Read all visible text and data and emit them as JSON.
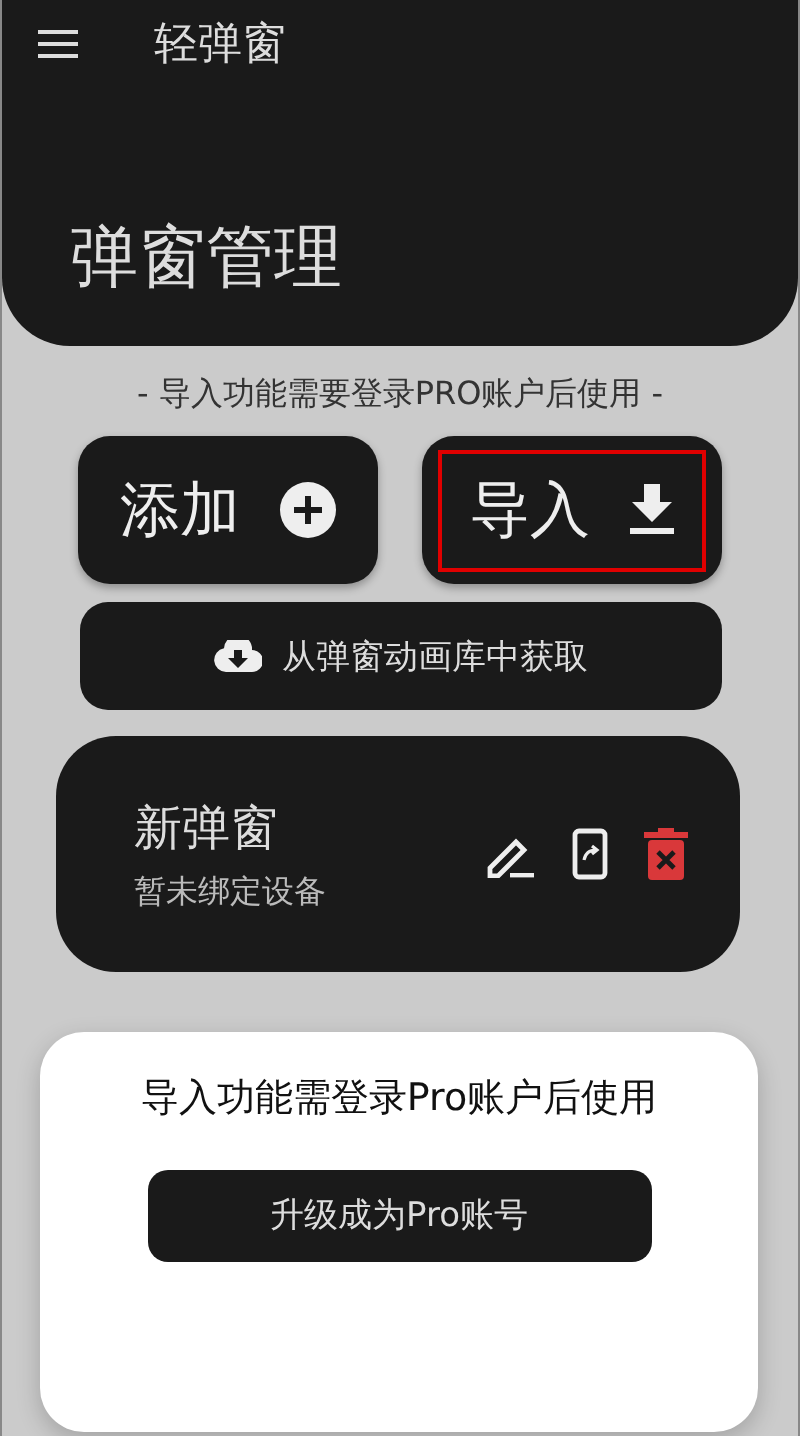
{
  "app_bar": {
    "title": "轻弹窗"
  },
  "header": {
    "title": "弹窗管理"
  },
  "notice": "- 导入功能需要登录PRO账户后使用 -",
  "actions": [
    {
      "label": "添加",
      "kind": "add",
      "highlighted": false
    },
    {
      "label": "导入",
      "kind": "import",
      "highlighted": true
    }
  ],
  "library_button": {
    "label": "从弹窗动画库中获取"
  },
  "popups": [
    {
      "name": "新弹窗",
      "status": "暂未绑定设备"
    }
  ],
  "dialog": {
    "message": "导入功能需登录Pro账户后使用",
    "button": "升级成为Pro账号"
  }
}
